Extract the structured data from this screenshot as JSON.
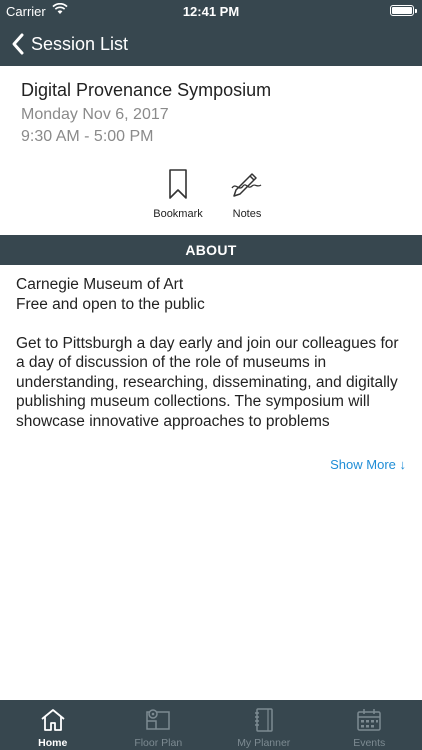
{
  "status_bar": {
    "carrier": "Carrier",
    "time": "12:41 PM",
    "battery_level": 1.0
  },
  "nav": {
    "back_label": "Session List",
    "back_icon": "chevron-left-icon"
  },
  "session": {
    "title": "Digital Provenance Symposium",
    "date": "Monday Nov 6, 2017",
    "time": "9:30 AM - 5:00 PM"
  },
  "actions": [
    {
      "label": "Bookmark",
      "icon": "bookmark-icon"
    },
    {
      "label": "Notes",
      "icon": "notes-pen-icon"
    }
  ],
  "about": {
    "header": "ABOUT",
    "location": "Carnegie Museum of Art",
    "admission": "Free and open to the public",
    "description": "Get to Pittsburgh a day early and join our colleagues for a day of discussion of the role of museums in understanding, researching, disseminating, and digitally publishing museum collections. The symposium will showcase innovative approaches to problems",
    "show_more": "Show More ↓"
  },
  "tabs": [
    {
      "label": "Home",
      "icon": "home-icon",
      "active": true
    },
    {
      "label": "Floor Plan",
      "icon": "floor-plan-icon",
      "active": false
    },
    {
      "label": "My Planner",
      "icon": "planner-icon",
      "active": false
    },
    {
      "label": "Events",
      "icon": "calendar-icon",
      "active": false
    }
  ],
  "colors": {
    "bar_background": "#37474f",
    "link": "#1f8dd6",
    "muted_text": "#8a8a8a",
    "inactive_tab": "#7d8b92"
  }
}
